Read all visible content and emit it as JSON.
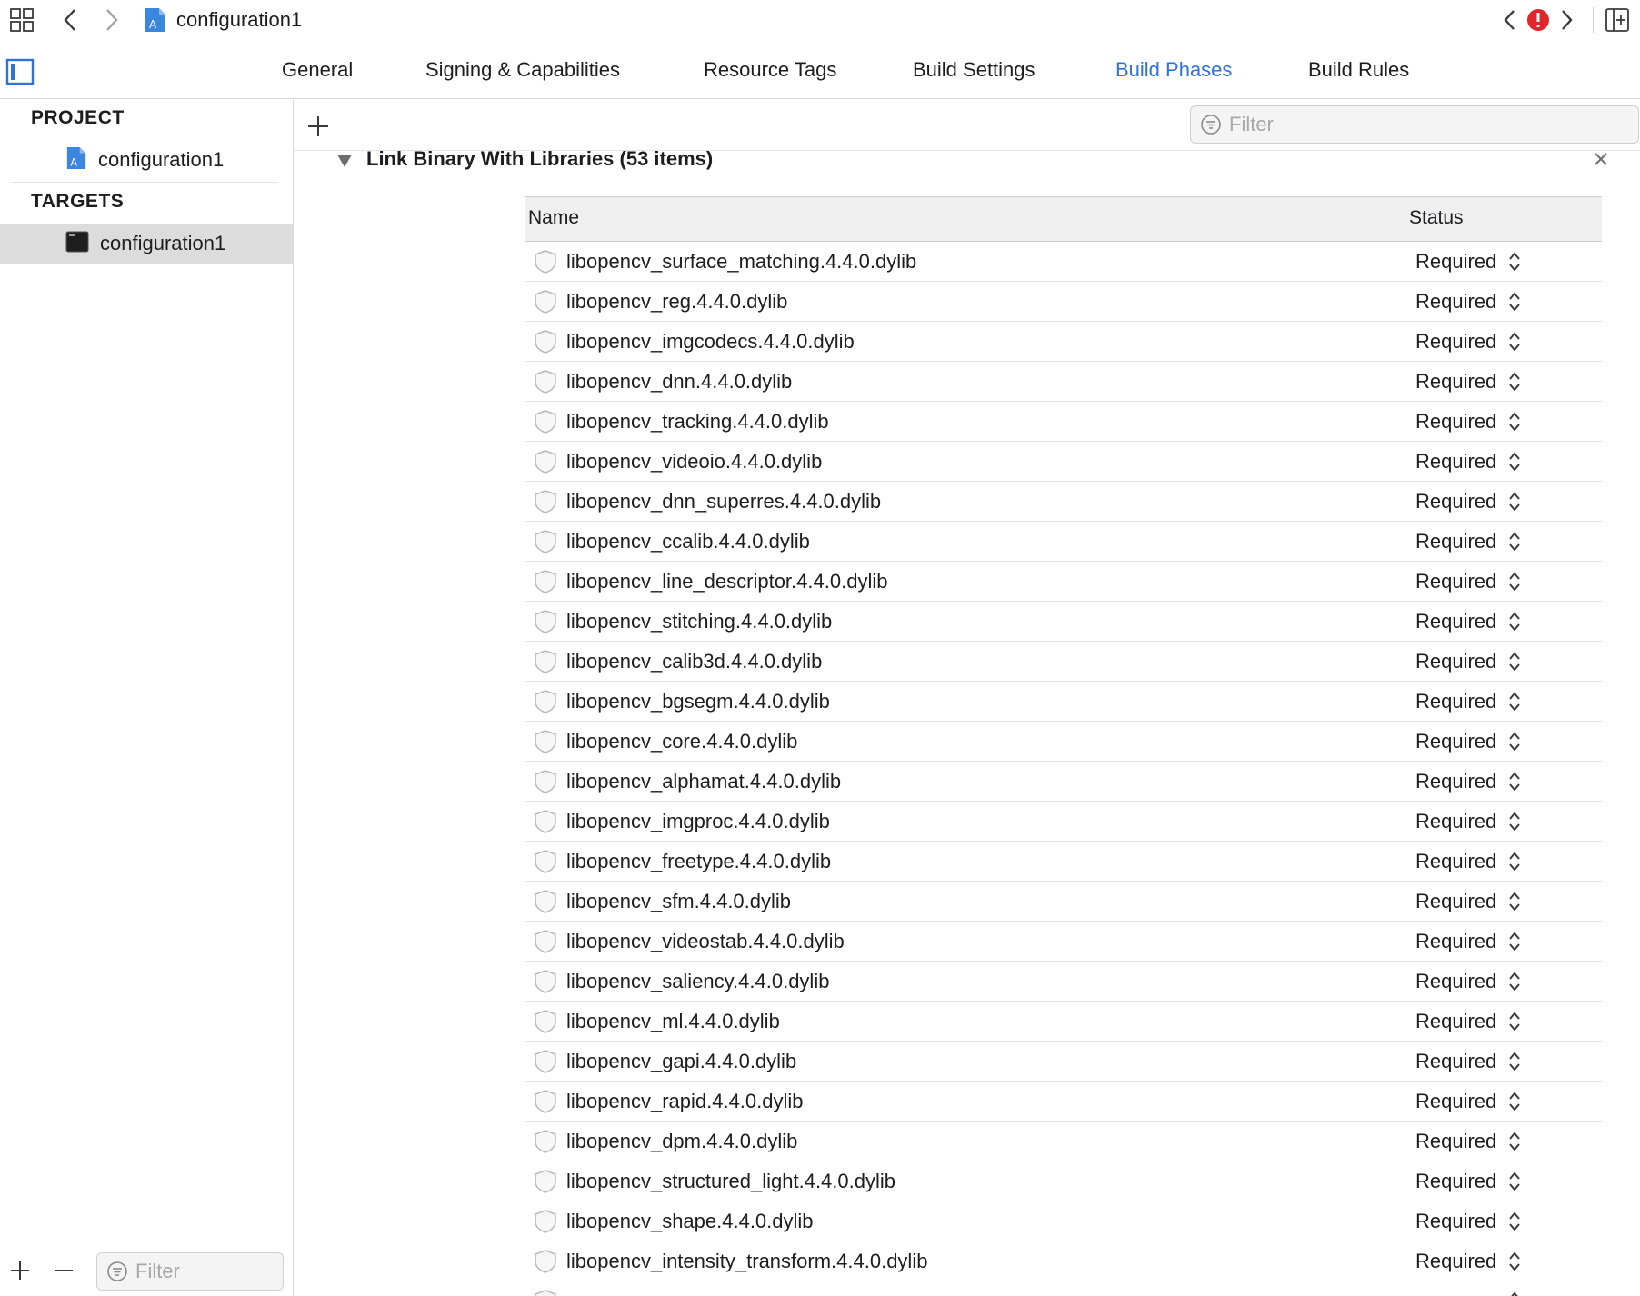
{
  "toolbar": {
    "document_title": "configuration1",
    "issue_badge": "!",
    "icons": [
      "grid-icon",
      "back-chevron-icon",
      "forward-chevron-icon",
      "project-file-icon",
      "prev-issue-icon",
      "error-badge-icon",
      "next-issue-icon",
      "add-editor-icon"
    ]
  },
  "tabs": [
    {
      "label": "General"
    },
    {
      "label": "Signing & Capabilities"
    },
    {
      "label": "Resource Tags"
    },
    {
      "label": "Build Settings"
    },
    {
      "label": "Build Phases",
      "active": true
    },
    {
      "label": "Build Rules"
    }
  ],
  "sidebar": {
    "project_header": "PROJECT",
    "project_item": "configuration1",
    "targets_header": "TARGETS",
    "target_item": "configuration1",
    "filter_placeholder": "Filter"
  },
  "content": {
    "filter_placeholder": "Filter",
    "phase_title": "Link Binary With Libraries (53 items)",
    "columns": {
      "name": "Name",
      "status": "Status"
    },
    "libraries": [
      {
        "name": "libopencv_surface_matching.4.4.0.dylib",
        "status": "Required"
      },
      {
        "name": "libopencv_reg.4.4.0.dylib",
        "status": "Required"
      },
      {
        "name": "libopencv_imgcodecs.4.4.0.dylib",
        "status": "Required"
      },
      {
        "name": "libopencv_dnn.4.4.0.dylib",
        "status": "Required"
      },
      {
        "name": "libopencv_tracking.4.4.0.dylib",
        "status": "Required"
      },
      {
        "name": "libopencv_videoio.4.4.0.dylib",
        "status": "Required"
      },
      {
        "name": "libopencv_dnn_superres.4.4.0.dylib",
        "status": "Required"
      },
      {
        "name": "libopencv_ccalib.4.4.0.dylib",
        "status": "Required"
      },
      {
        "name": "libopencv_line_descriptor.4.4.0.dylib",
        "status": "Required"
      },
      {
        "name": "libopencv_stitching.4.4.0.dylib",
        "status": "Required"
      },
      {
        "name": "libopencv_calib3d.4.4.0.dylib",
        "status": "Required"
      },
      {
        "name": "libopencv_bgsegm.4.4.0.dylib",
        "status": "Required"
      },
      {
        "name": "libopencv_core.4.4.0.dylib",
        "status": "Required"
      },
      {
        "name": "libopencv_alphamat.4.4.0.dylib",
        "status": "Required"
      },
      {
        "name": "libopencv_imgproc.4.4.0.dylib",
        "status": "Required"
      },
      {
        "name": "libopencv_freetype.4.4.0.dylib",
        "status": "Required"
      },
      {
        "name": "libopencv_sfm.4.4.0.dylib",
        "status": "Required"
      },
      {
        "name": "libopencv_videostab.4.4.0.dylib",
        "status": "Required"
      },
      {
        "name": "libopencv_saliency.4.4.0.dylib",
        "status": "Required"
      },
      {
        "name": "libopencv_ml.4.4.0.dylib",
        "status": "Required"
      },
      {
        "name": "libopencv_gapi.4.4.0.dylib",
        "status": "Required"
      },
      {
        "name": "libopencv_rapid.4.4.0.dylib",
        "status": "Required"
      },
      {
        "name": "libopencv_dpm.4.4.0.dylib",
        "status": "Required"
      },
      {
        "name": "libopencv_structured_light.4.4.0.dylib",
        "status": "Required"
      },
      {
        "name": "libopencv_shape.4.4.0.dylib",
        "status": "Required"
      },
      {
        "name": "libopencv_intensity_transform.4.4.0.dylib",
        "status": "Required"
      },
      {
        "name": "",
        "status": ""
      }
    ]
  },
  "colors": {
    "accent": "#2f72d8",
    "error": "#e0262a",
    "selection": "#dcdcdc"
  }
}
